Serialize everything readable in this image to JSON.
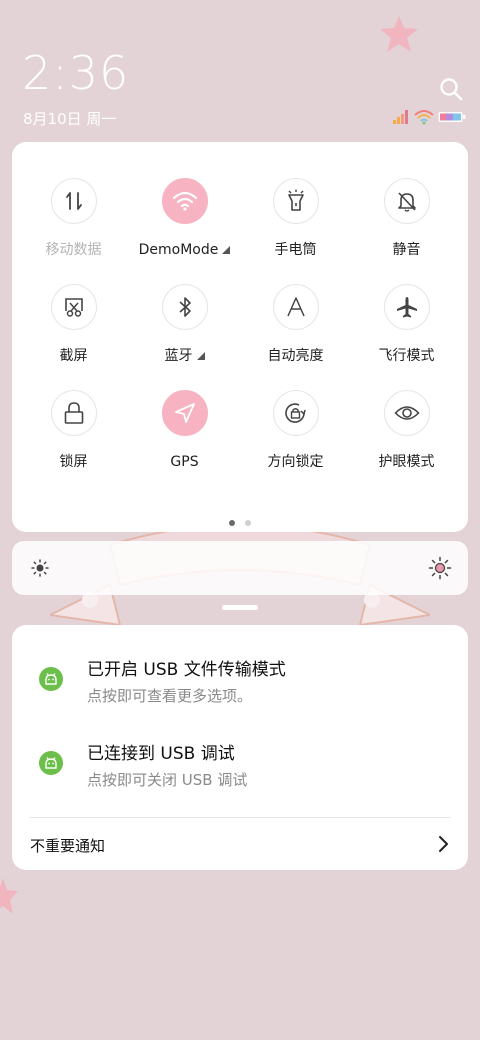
{
  "status": {
    "time": "2:36",
    "date": "8月10日 周一"
  },
  "quick_settings": {
    "tiles": [
      {
        "label": "移动数据",
        "icon": "mobile-data-icon",
        "active": false,
        "dim": true
      },
      {
        "label": "DemoMode",
        "icon": "wifi-icon",
        "active": true,
        "expand": true
      },
      {
        "label": "手电筒",
        "icon": "flashlight-icon",
        "active": false
      },
      {
        "label": "静音",
        "icon": "mute-bell-icon",
        "active": false
      },
      {
        "label": "截屏",
        "icon": "screenshot-icon",
        "active": false
      },
      {
        "label": "蓝牙",
        "icon": "bluetooth-icon",
        "active": false,
        "expand": true
      },
      {
        "label": "自动亮度",
        "icon": "auto-brightness-icon",
        "active": false
      },
      {
        "label": "飞行模式",
        "icon": "airplane-icon",
        "active": false
      },
      {
        "label": "锁屏",
        "icon": "lock-icon",
        "active": false
      },
      {
        "label": "GPS",
        "icon": "location-icon",
        "active": true
      },
      {
        "label": "方向锁定",
        "icon": "rotation-lock-icon",
        "active": false
      },
      {
        "label": "护眼模式",
        "icon": "eye-icon",
        "active": false
      }
    ],
    "page_count": 2,
    "current_page": 1
  },
  "notifications": [
    {
      "title": "已开启  USB  文件传输模式",
      "subtitle": "点按即可查看更多选项。",
      "icon": "android-icon"
    },
    {
      "title": "已连接到  USB  调试",
      "subtitle": "点按即可关闭 USB 调试",
      "icon": "android-icon"
    }
  ],
  "unimportant_label": "不重要通知",
  "colors": {
    "active_tile": "#f8b3c2",
    "background": "#e4d3d6",
    "notif_icon": "#6cbf4a"
  }
}
